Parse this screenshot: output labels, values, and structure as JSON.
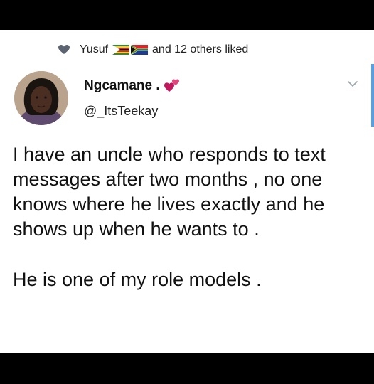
{
  "social_context": {
    "liker": "Yusuf",
    "rest": "and 12 others liked"
  },
  "author": {
    "display_name": "Ngcamane .",
    "handle": "@_ItsTeekay"
  },
  "tweet": {
    "paragraphs": [
      "I have an uncle who responds to text messages after two months , no one knows where he lives exactly and he shows up when he wants to .",
      "He is one of my role models ."
    ]
  },
  "icons": {
    "like": "heart-icon",
    "flags": [
      "zimbabwe-flag-icon",
      "south-africa-flag-icon"
    ],
    "name_emoji": "two-hearts-icon",
    "menu": "chevron-down-icon"
  },
  "colors": {
    "background": "#000000",
    "card": "#ffffff",
    "text": "#111111",
    "accent": "#5aa0e0",
    "heart": "#c2185b"
  }
}
